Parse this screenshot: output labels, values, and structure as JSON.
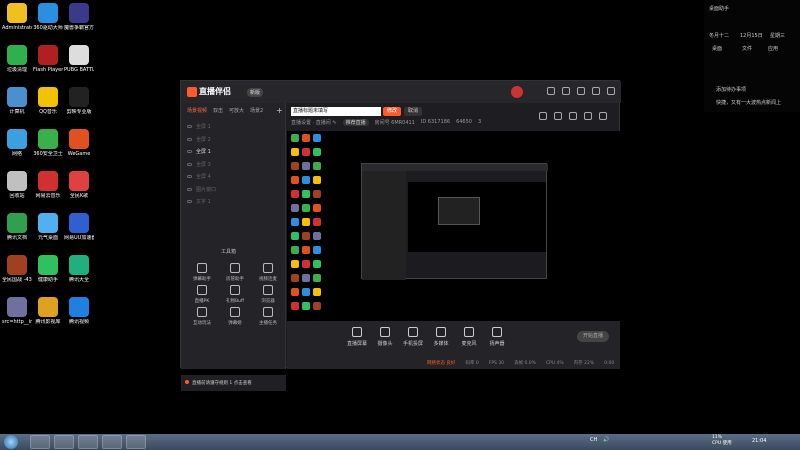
{
  "desktop": {
    "icons": [
      {
        "label": "Administrato",
        "color": "#f0c020"
      },
      {
        "label": "360驱动大师",
        "color": "#2a8fe0"
      },
      {
        "label": "魔兽争霸官方对战平台",
        "color": "#3a3a8a"
      },
      {
        "label": "垃圾清理",
        "color": "#2fb04a"
      },
      {
        "label": "Flash Player 修复工具",
        "color": "#b02020"
      },
      {
        "label": "PUBG BATTLEGR...",
        "color": "#dddddd"
      },
      {
        "label": "计算机",
        "color": "#4a90d0"
      },
      {
        "label": "QQ音乐",
        "color": "#f2c200"
      },
      {
        "label": "剪映专业版",
        "color": "#222222"
      },
      {
        "label": "网络",
        "color": "#3aa0e0"
      },
      {
        "label": "360安全卫士",
        "color": "#3ab04a"
      },
      {
        "label": "WeGame",
        "color": "#e05020"
      },
      {
        "label": "回收站",
        "color": "#c0c0c0"
      },
      {
        "label": "网易云音乐",
        "color": "#d03030"
      },
      {
        "label": "全民K歌",
        "color": "#e04040"
      },
      {
        "label": "腾讯文档",
        "color": "#30a050"
      },
      {
        "label": "元气桌面",
        "color": "#50b0f0"
      },
      {
        "label": "网易UU加速器",
        "color": "#3060d0"
      },
      {
        "label": "全民国战 -4399",
        "color": "#a04020"
      },
      {
        "label": "健康助手",
        "color": "#30c060"
      },
      {
        "label": "腾讯大全",
        "color": "#20b080"
      },
      {
        "label": "src=http__images.k12...",
        "color": "#7070a0"
      },
      {
        "label": "腾讯影视库",
        "color": "#e0a020"
      },
      {
        "label": "腾讯视频",
        "color": "#2080e0"
      }
    ]
  },
  "widget": {
    "title": "桌面助手",
    "lunar": "冬月十二",
    "date": "12月15日",
    "weekday": "星期三",
    "btn_desktop": "桌面",
    "btn_files": "文件",
    "btn_apps": "应用",
    "todo": "添加待办事项",
    "tip": "快捷，又有一大波热点新闻上"
  },
  "app": {
    "logo": "直播伴侣",
    "version": "新版",
    "scene_tabs": [
      "场景视频",
      "双击",
      "可放大",
      "场景2"
    ],
    "layers": [
      "全屏 1",
      "全屏 2",
      "全屏 1",
      "全屏 3",
      "全屏 4",
      "图片窗口",
      "文字 1"
    ],
    "tools_title": "工具箱",
    "tools": [
      "弹幕助手",
      "房管助手",
      "视频连麦",
      "直播PK",
      "礼物Buff",
      "浏览器",
      "互动玩法",
      "弹幕姬",
      "主播任务"
    ],
    "title_input": "直播标题未填写",
    "modify_btn": "修改",
    "cancel_btn": "取消",
    "info": [
      "直播设置 · 直播间 ✎",
      "推荐直播",
      "房间号 6MR0411",
      "ID 6317186",
      "64650",
      "3"
    ],
    "bottom_tools": [
      "直播屏幕",
      "摄像头",
      "手机投屏",
      "多媒体",
      "麦克风",
      "扬声器"
    ],
    "start_btn": "开始直播",
    "status": [
      "网络状态 良好",
      "码率 0",
      "FPS 30",
      "丢帧 0.0%",
      "CPU 4%",
      "内存 22%",
      "0:00"
    ],
    "notice": "直播前请遵守规则 1 点击查看"
  },
  "taskbar": {
    "tray": [
      "CH",
      "🔊"
    ],
    "cpu": "11%",
    "cpu_label": "CPU 使用",
    "clock": "21:04"
  }
}
